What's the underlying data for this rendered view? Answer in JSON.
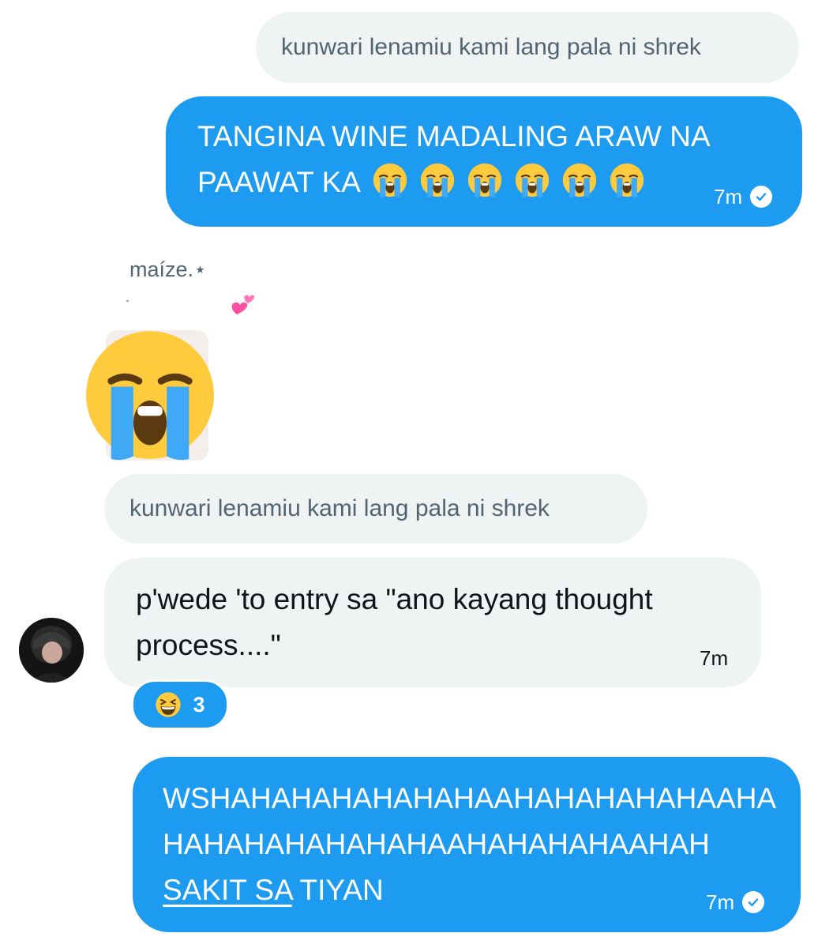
{
  "messages": {
    "quote_1": "kunwari lenamiu kami lang pala ni shrek",
    "sent_1": {
      "line1": "TANGINA WINE MADALING ARAW NA",
      "line2": "PAAWAT KA",
      "emoji_count": 6,
      "time": "7m"
    },
    "sender_name": "maíze.⋆",
    "sender_name_emoji": "💕",
    "quote_2": "kunwari lenamiu kami lang pala ni shrek",
    "received": {
      "line1": "p'wede 'to entry sa \"ano kayang thought",
      "line2": "process....\"",
      "time": "7m",
      "reaction_count": "3"
    },
    "sent_2": {
      "line1": "WSHAHAHAHAHAHAHAAHAHAHAHAHAAHA",
      "line2": "HAHAHAHAHAHAHAAHAHAHAHAAHAH",
      "line3_underlined": "SAKIT SA",
      "line3_rest": " TIYAN",
      "time": "7m"
    }
  },
  "colors": {
    "accent": "#1d9bf0",
    "bubble_gray": "#eff3f4",
    "muted_text": "#536471",
    "dark_text": "#0f1419"
  }
}
